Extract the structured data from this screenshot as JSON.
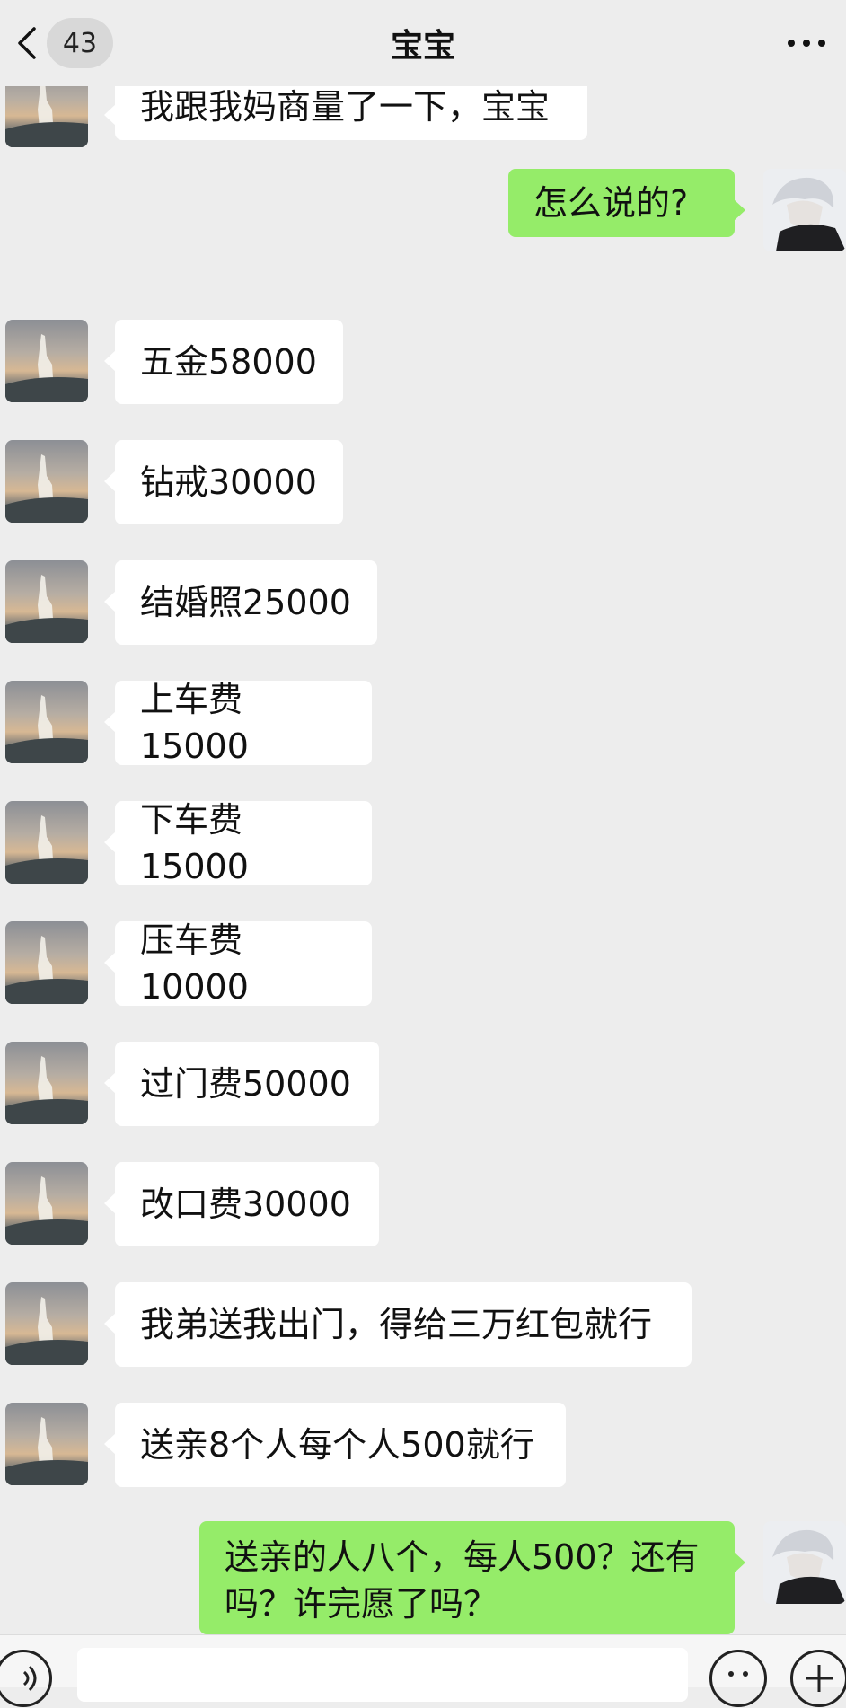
{
  "header": {
    "title": "宝宝",
    "unread_count": "43"
  },
  "messages": [
    {
      "side": "left",
      "text": "我跟我妈商量了一下，宝宝"
    },
    {
      "side": "right",
      "text": "怎么说的?"
    },
    {
      "side": "left",
      "text": "五金58000"
    },
    {
      "side": "left",
      "text": "钻戒30000"
    },
    {
      "side": "left",
      "text": "结婚照25000"
    },
    {
      "side": "left",
      "text": "上车费15000"
    },
    {
      "side": "left",
      "text": "下车费15000"
    },
    {
      "side": "left",
      "text": "压车费10000"
    },
    {
      "side": "left",
      "text": "过门费50000"
    },
    {
      "side": "left",
      "text": "改口费30000"
    },
    {
      "side": "left",
      "text": "我弟送我出门，得给三万红包就行"
    },
    {
      "side": "left",
      "text": "送亲8个人每个人500就行"
    },
    {
      "side": "right",
      "text": "送亲的人八个，每人500？还有吗？许完愿了吗？"
    }
  ],
  "colors": {
    "background": "#ededed",
    "incoming_bubble": "#ffffff",
    "outgoing_bubble": "#95ec69"
  },
  "icons": {
    "back": "chevron-left-icon",
    "more": "more-dots-icon",
    "voice": "voice-icon",
    "emoji": "emoji-icon",
    "plus": "plus-icon"
  }
}
